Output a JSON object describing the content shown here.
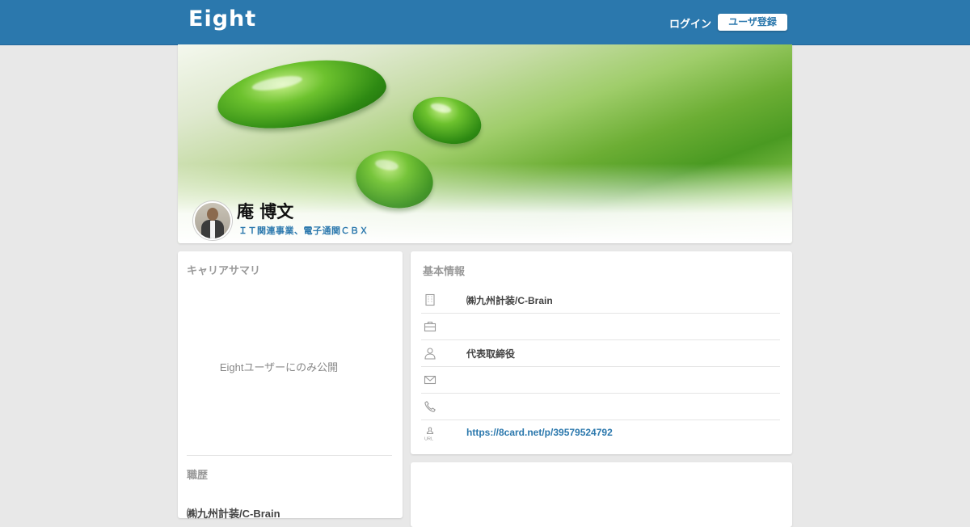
{
  "header": {
    "logo": "Eight",
    "login_label": "ログイン",
    "register_label": "ユーザ登録"
  },
  "profile": {
    "name": "庵 博文",
    "subtitle": "ＩＴ関連事業、電子通関ＣＢＸ"
  },
  "career": {
    "title": "キャリアサマリ",
    "private_note": "Eightユーザーにのみ公開",
    "history_title": "職歴",
    "history_item": "㈱九州計装/C-Brain"
  },
  "basic_info": {
    "title": "基本情報",
    "rows": [
      {
        "icon": "building-icon",
        "value": "㈱九州計装/C-Brain"
      },
      {
        "icon": "briefcase-icon",
        "value": ""
      },
      {
        "icon": "person-icon",
        "value": "代表取締役"
      },
      {
        "icon": "mail-icon",
        "value": ""
      },
      {
        "icon": "phone-icon",
        "value": ""
      },
      {
        "icon": "url-icon",
        "value": "https://8card.net/p/39579524792"
      }
    ]
  },
  "colors": {
    "header_bg": "#2b78ad",
    "accent": "#2b78ad",
    "page_bg": "#e8e8e8"
  }
}
